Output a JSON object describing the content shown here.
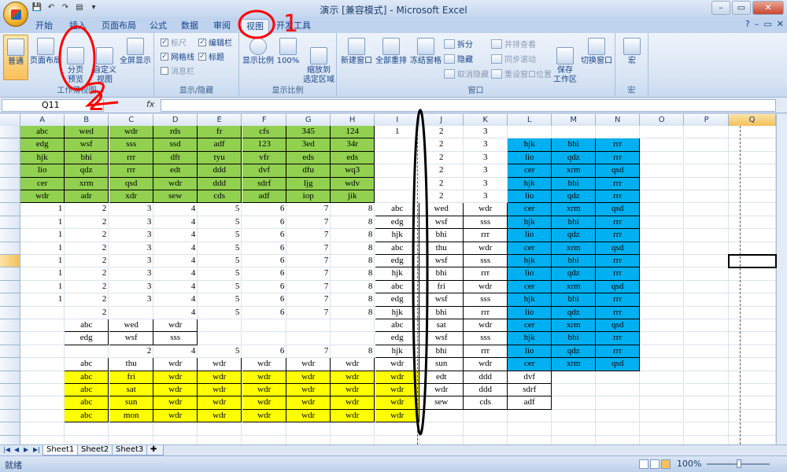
{
  "titlebar": {
    "title": "演示 [兼容模式] - Microsoft Excel"
  },
  "tabs": [
    "开始",
    "插入",
    "页面布局",
    "公式",
    "数据",
    "审阅",
    "视图",
    "开发工具"
  ],
  "active_tab": "视图",
  "ribbon": {
    "workbook_views": {
      "label": "工作簿视图",
      "buttons": [
        "普通",
        "页面布局",
        "分页\n预览",
        "自定义\n视图",
        "全屏显示"
      ]
    },
    "show_hide": {
      "label": "显示/隐藏",
      "items": [
        {
          "label": "标尺",
          "checked": true,
          "disabled": true
        },
        {
          "label": "编辑栏",
          "checked": true
        },
        {
          "label": "网格线",
          "checked": true
        },
        {
          "label": "标题",
          "checked": true
        },
        {
          "label": "消息栏",
          "checked": false,
          "disabled": true
        }
      ]
    },
    "zoom": {
      "label": "显示比例",
      "buttons": [
        "显示比例",
        "100%",
        "缩放到\n选定区域"
      ]
    },
    "window": {
      "label": "窗口",
      "buttons": [
        "新建窗口",
        "全部重排",
        "冻结窗格",
        "拆分",
        "隐藏",
        "取消隐藏",
        "并排查看",
        "同步滚动",
        "重设窗口位置",
        "保存\n工作区",
        "切换窗口"
      ]
    },
    "macros": {
      "label": "宏",
      "buttons": [
        "宏"
      ]
    }
  },
  "formula": {
    "namebox": "Q11",
    "fx": "fx"
  },
  "columns": [
    "A",
    "B",
    "C",
    "D",
    "E",
    "F",
    "G",
    "H",
    "I",
    "J",
    "K",
    "L",
    "M",
    "N",
    "O",
    "P",
    "Q"
  ],
  "selected": {
    "col": "Q",
    "row": "11"
  },
  "rows": [
    "1",
    "2",
    "3",
    "4",
    "5",
    "6",
    "7",
    "8",
    "9",
    "10",
    "11",
    "12",
    "13",
    "14",
    "15",
    "16",
    "17",
    "18",
    "19",
    "20",
    "21",
    "22",
    "23",
    "24",
    "25"
  ],
  "cells": {
    "A": [
      "abc",
      "edg",
      "hjk",
      "lio",
      "cer",
      "wdr",
      "1",
      "1",
      "1",
      "1",
      "1",
      "1",
      "1",
      "1",
      "",
      "",
      "",
      "",
      "",
      "",
      "",
      "",
      "",
      "",
      ""
    ],
    "B": [
      "wed",
      "wsf",
      "bhi",
      "qdz",
      "xrm",
      "adr",
      "2",
      "2",
      "2",
      "2",
      "2",
      "2",
      "2",
      "2",
      "2",
      "abc",
      "edg",
      "",
      "abc",
      "abc",
      "abc",
      "abc",
      "abc",
      "",
      ""
    ],
    "C": [
      "wdr",
      "sss",
      "rrr",
      "rrr",
      "qsd",
      "xdr",
      "3",
      "3",
      "3",
      "3",
      "3",
      "3",
      "3",
      "3",
      "",
      "wed",
      "wsf",
      "2",
      "thu",
      "fri",
      "sat",
      "sun",
      "mon",
      "",
      ""
    ],
    "D": [
      "rds",
      "ssd",
      "dft",
      "edt",
      "wdr",
      "sew",
      "4",
      "4",
      "4",
      "4",
      "4",
      "4",
      "4",
      "4",
      "4",
      "wdr",
      "sss",
      "4",
      "wdr",
      "wdr",
      "wdr",
      "wdr",
      "wdr",
      "",
      ""
    ],
    "E": [
      "fr",
      "adf",
      "tyu",
      "ddd",
      "ddd",
      "cds",
      "5",
      "5",
      "5",
      "5",
      "5",
      "5",
      "5",
      "5",
      "5",
      "",
      "",
      "5",
      "wdr",
      "wdr",
      "wdr",
      "wdr",
      "wdr",
      "",
      ""
    ],
    "F": [
      "cfs",
      "123",
      "vfr",
      "dvf",
      "sdrf",
      "adf",
      "6",
      "6",
      "6",
      "6",
      "6",
      "6",
      "6",
      "6",
      "6",
      "",
      "",
      "6",
      "wdr",
      "wdr",
      "wdr",
      "wdr",
      "wdr",
      "",
      ""
    ],
    "G": [
      "345",
      "3ed",
      "eds",
      "dfu",
      "ljg",
      "iop",
      "7",
      "7",
      "7",
      "7",
      "7",
      "7",
      "7",
      "7",
      "7",
      "",
      "",
      "7",
      "wdr",
      "wdr",
      "wdr",
      "wdr",
      "wdr",
      "",
      ""
    ],
    "H": [
      "124",
      "34r",
      "eds",
      "wq3",
      "wdv",
      "jik",
      "8",
      "8",
      "8",
      "8",
      "8",
      "8",
      "8",
      "8",
      "8",
      "",
      "",
      "8",
      "wdr",
      "wdr",
      "wdr",
      "wdr",
      "wdr",
      "",
      ""
    ],
    "I": [
      "1",
      "",
      "",
      "",
      "",
      "",
      "abc",
      "edg",
      "hjk",
      "abc",
      "edg",
      "hjk",
      "abc",
      "edg",
      "hjk",
      "abc",
      "edg",
      "hjk",
      "wdr",
      "wdr",
      "wdr",
      "wdr",
      "wdr",
      "",
      ""
    ],
    "J": [
      "2",
      "2",
      "2",
      "2",
      "2",
      "2",
      "wed",
      "wsf",
      "bhi",
      "thu",
      "wsf",
      "bhi",
      "fri",
      "wsf",
      "bhi",
      "sat",
      "wsf",
      "bhi",
      "sun",
      "edt",
      "wdr",
      "sew",
      "",
      "",
      ""
    ],
    "K": [
      "3",
      "3",
      "3",
      "3",
      "3",
      "3",
      "wdr",
      "sss",
      "rrr",
      "wdr",
      "sss",
      "rrr",
      "wdr",
      "sss",
      "rrr",
      "wdr",
      "sss",
      "rrr",
      "wdr",
      "ddd",
      "ddd",
      "cds",
      "",
      "",
      ""
    ],
    "L": [
      "",
      "hjk",
      "lio",
      "cer",
      "hjk",
      "lio",
      "cer",
      "hjk",
      "lio",
      "cer",
      "hjk",
      "lio",
      "cer",
      "hjk",
      "lio",
      "cer",
      "hjk",
      "lio",
      "cer",
      "dvf",
      "sdrf",
      "adf",
      "",
      "",
      ""
    ],
    "M": [
      "",
      "bhi",
      "qdz",
      "xrm",
      "bhi",
      "qdz",
      "xrm",
      "bhi",
      "qdz",
      "xrm",
      "bhi",
      "qdz",
      "xrm",
      "bhi",
      "qdz",
      "xrm",
      "bhi",
      "qdz",
      "xrm",
      "",
      "",
      "",
      "",
      "",
      ""
    ],
    "N": [
      "",
      "rrr",
      "rrr",
      "qsd",
      "rrr",
      "rrr",
      "qsd",
      "rrr",
      "rrr",
      "qsd",
      "rrr",
      "rrr",
      "qsd",
      "rrr",
      "rrr",
      "qsd",
      "rrr",
      "rrr",
      "qsd",
      "",
      "",
      "",
      "",
      "",
      ""
    ]
  },
  "sheets": [
    "Sheet1",
    "Sheet2",
    "Sheet3"
  ],
  "status": {
    "text": "就绪",
    "zoom": "100%"
  },
  "annotations": [
    "1",
    "2"
  ],
  "colors": {
    "green": "#92d050",
    "blue": "#00b0f0",
    "yellow": "#ffff00",
    "annotation": "#ff0000"
  }
}
